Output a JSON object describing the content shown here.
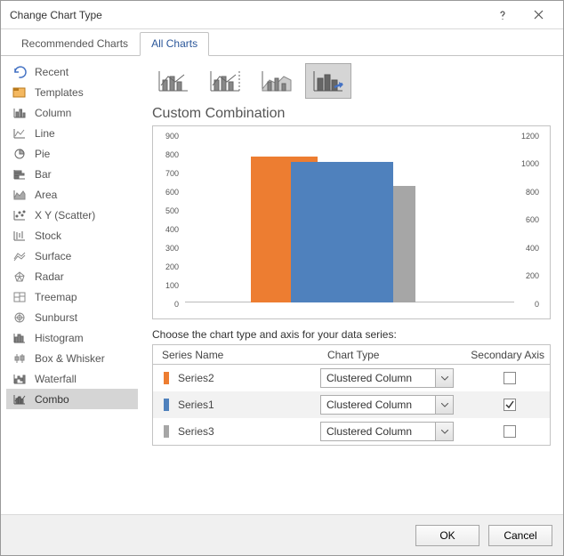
{
  "title": "Change Chart Type",
  "tabs": {
    "recommended": "Recommended Charts",
    "all": "All Charts"
  },
  "sidebar": [
    {
      "label": "Recent"
    },
    {
      "label": "Templates"
    },
    {
      "label": "Column"
    },
    {
      "label": "Line"
    },
    {
      "label": "Pie"
    },
    {
      "label": "Bar"
    },
    {
      "label": "Area"
    },
    {
      "label": "X Y (Scatter)"
    },
    {
      "label": "Stock"
    },
    {
      "label": "Surface"
    },
    {
      "label": "Radar"
    },
    {
      "label": "Treemap"
    },
    {
      "label": "Sunburst"
    },
    {
      "label": "Histogram"
    },
    {
      "label": "Box & Whisker"
    },
    {
      "label": "Waterfall"
    },
    {
      "label": "Combo"
    }
  ],
  "section_title": "Custom Combination",
  "instruction": "Choose the chart type and axis for your data series:",
  "table": {
    "headers": {
      "name": "Series Name",
      "type": "Chart Type",
      "axis": "Secondary Axis"
    }
  },
  "series": [
    {
      "name": "Series2",
      "color": "#ed7d31",
      "chartType": "Clustered Column",
      "secondary": false
    },
    {
      "name": "Series1",
      "color": "#4f81bd",
      "chartType": "Clustered Column",
      "secondary": true
    },
    {
      "name": "Series3",
      "color": "#a6a6a6",
      "chartType": "Clustered Column",
      "secondary": false
    }
  ],
  "buttons": {
    "ok": "OK",
    "cancel": "Cancel"
  },
  "chart_data": {
    "type": "bar",
    "title": "",
    "left_axis": {
      "ticks": [
        0,
        100,
        200,
        300,
        400,
        500,
        600,
        700,
        800,
        900
      ],
      "range": [
        0,
        900
      ]
    },
    "right_axis": {
      "ticks": [
        0,
        200,
        400,
        600,
        800,
        1000,
        1200
      ],
      "range": [
        0,
        1200
      ]
    },
    "series": [
      {
        "name": "Series2",
        "color": "#ed7d31",
        "axis": "left",
        "value": 780
      },
      {
        "name": "Series1",
        "color": "#4f81bd",
        "axis": "right",
        "value": 1000
      },
      {
        "name": "Series3",
        "color": "#a6a6a6",
        "axis": "left",
        "value": 625
      }
    ]
  }
}
